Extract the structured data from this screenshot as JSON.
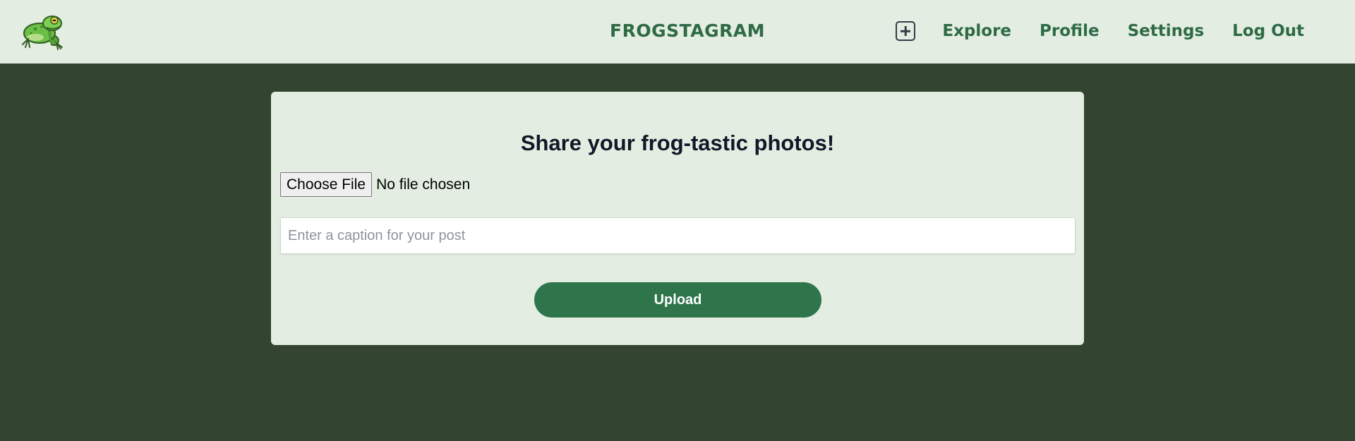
{
  "header": {
    "brand": "FROGSTAGRAM",
    "logo_icon": "frog-icon",
    "add_icon": "plus-square-icon",
    "nav": [
      {
        "label": "Explore"
      },
      {
        "label": "Profile"
      },
      {
        "label": "Settings"
      },
      {
        "label": "Log Out"
      }
    ]
  },
  "upload_form": {
    "title": "Share your frog-tastic photos!",
    "file_button_label": "Choose File",
    "file_status": "No file chosen",
    "caption_value": "",
    "caption_placeholder": "Enter a caption for your post",
    "submit_label": "Upload"
  },
  "colors": {
    "page_background": "#334430",
    "panel_background": "#e3ede2",
    "brand_green": "#2e6b45",
    "button_green": "#2e754b",
    "title_text": "#111827"
  }
}
